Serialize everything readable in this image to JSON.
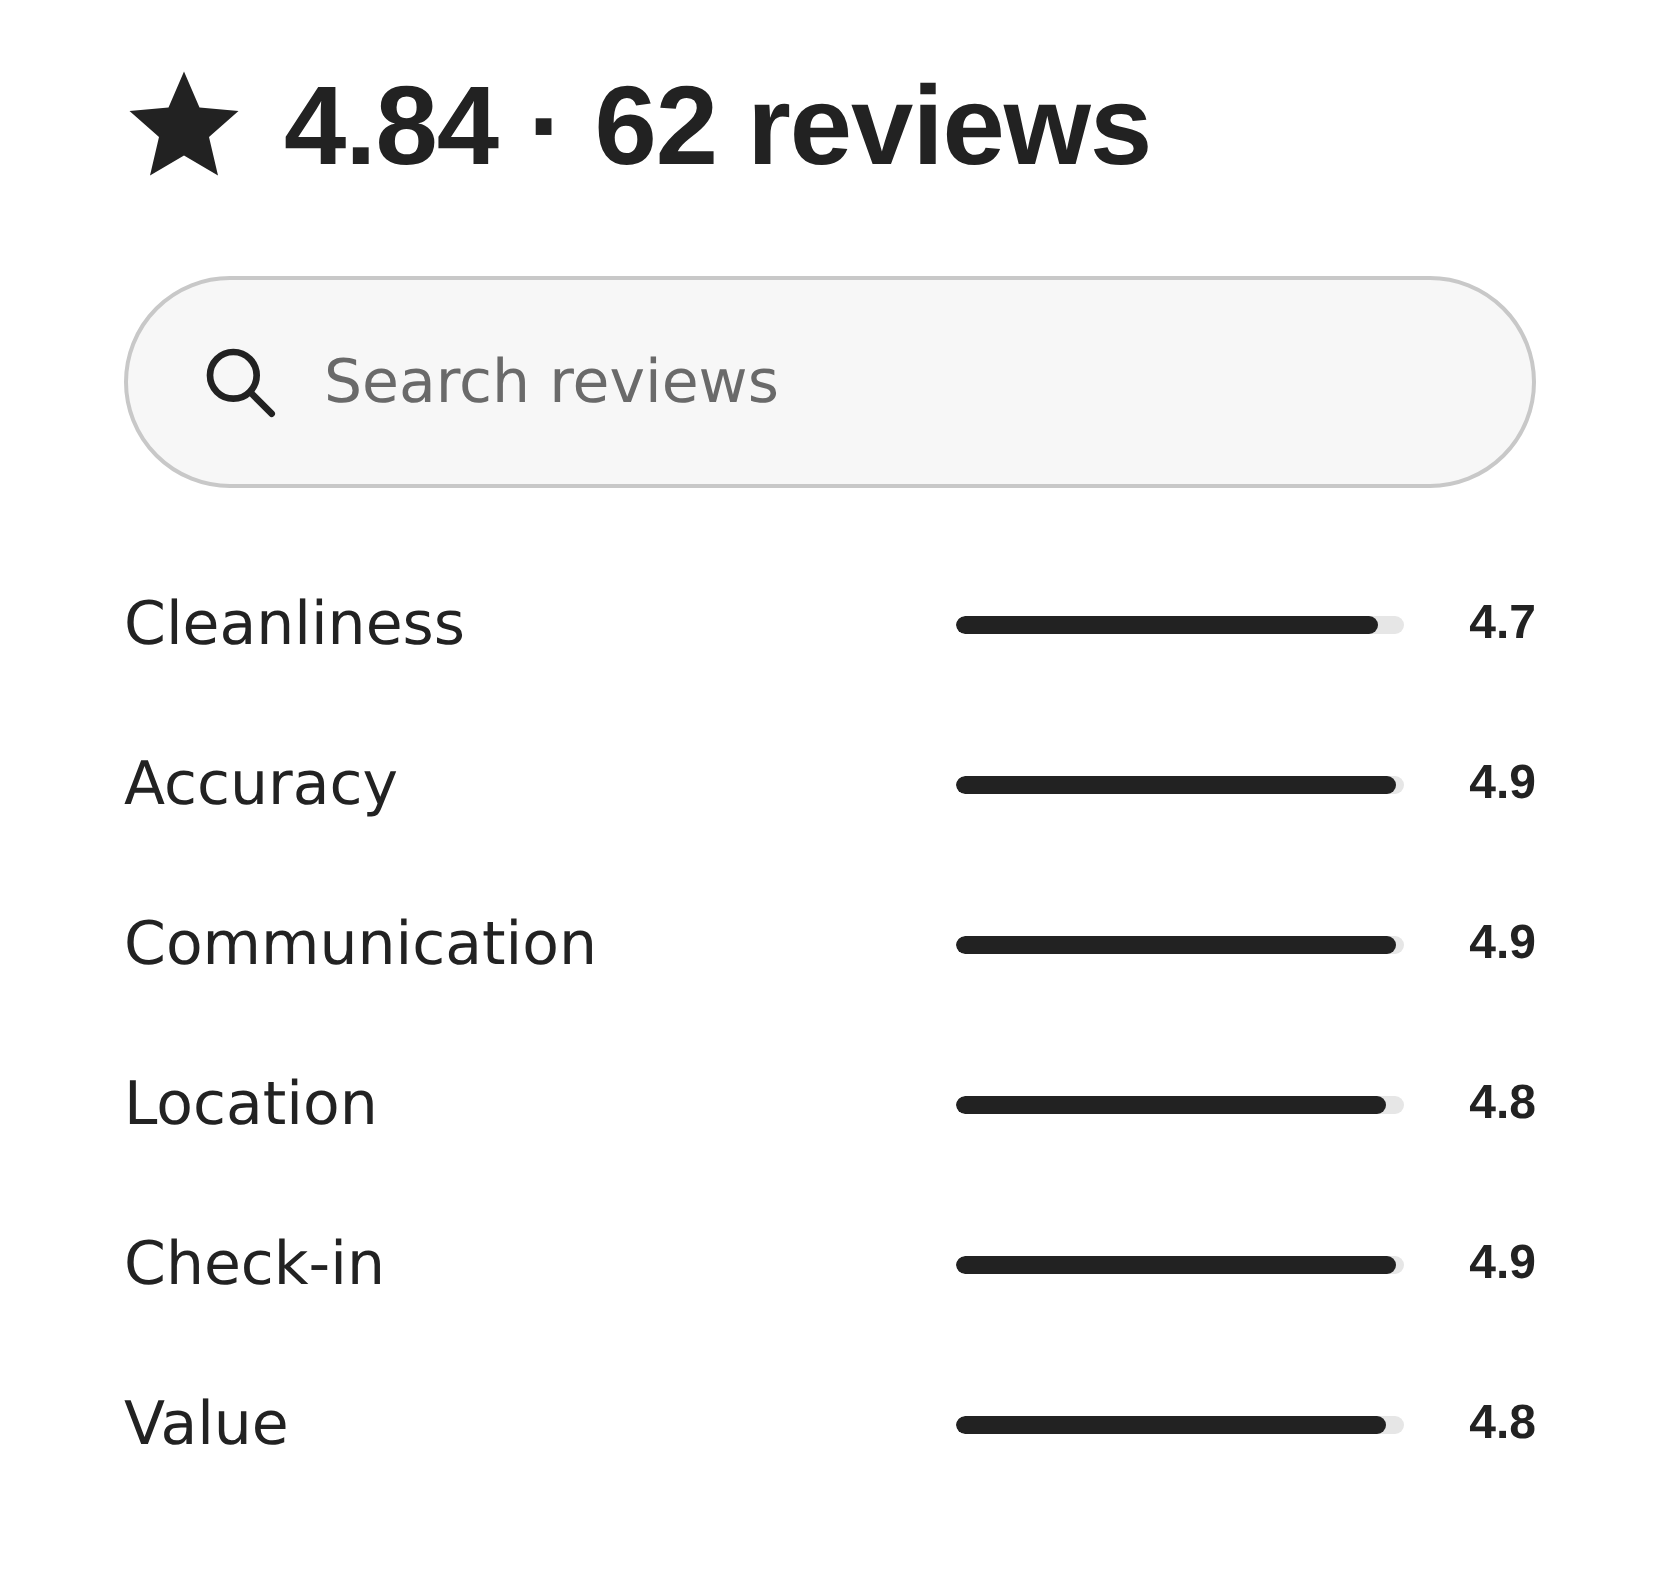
{
  "header": {
    "rating": "4.84",
    "separator": "·",
    "reviews": "62 reviews"
  },
  "search": {
    "placeholder": "Search reviews"
  },
  "categories": [
    {
      "label": "Cleanliness",
      "level": 0.94,
      "reading": "4.7"
    },
    {
      "label": "Accuracy",
      "level": 0.98,
      "reading": "4.9"
    },
    {
      "label": "Communication",
      "level": 0.98,
      "reading": "4.9"
    },
    {
      "label": "Location",
      "level": 0.96,
      "reading": "4.8"
    },
    {
      "label": "Check-in",
      "level": 0.98,
      "reading": "4.9"
    },
    {
      "label": "Value",
      "level": 0.96,
      "reading": "4.8"
    }
  ]
}
